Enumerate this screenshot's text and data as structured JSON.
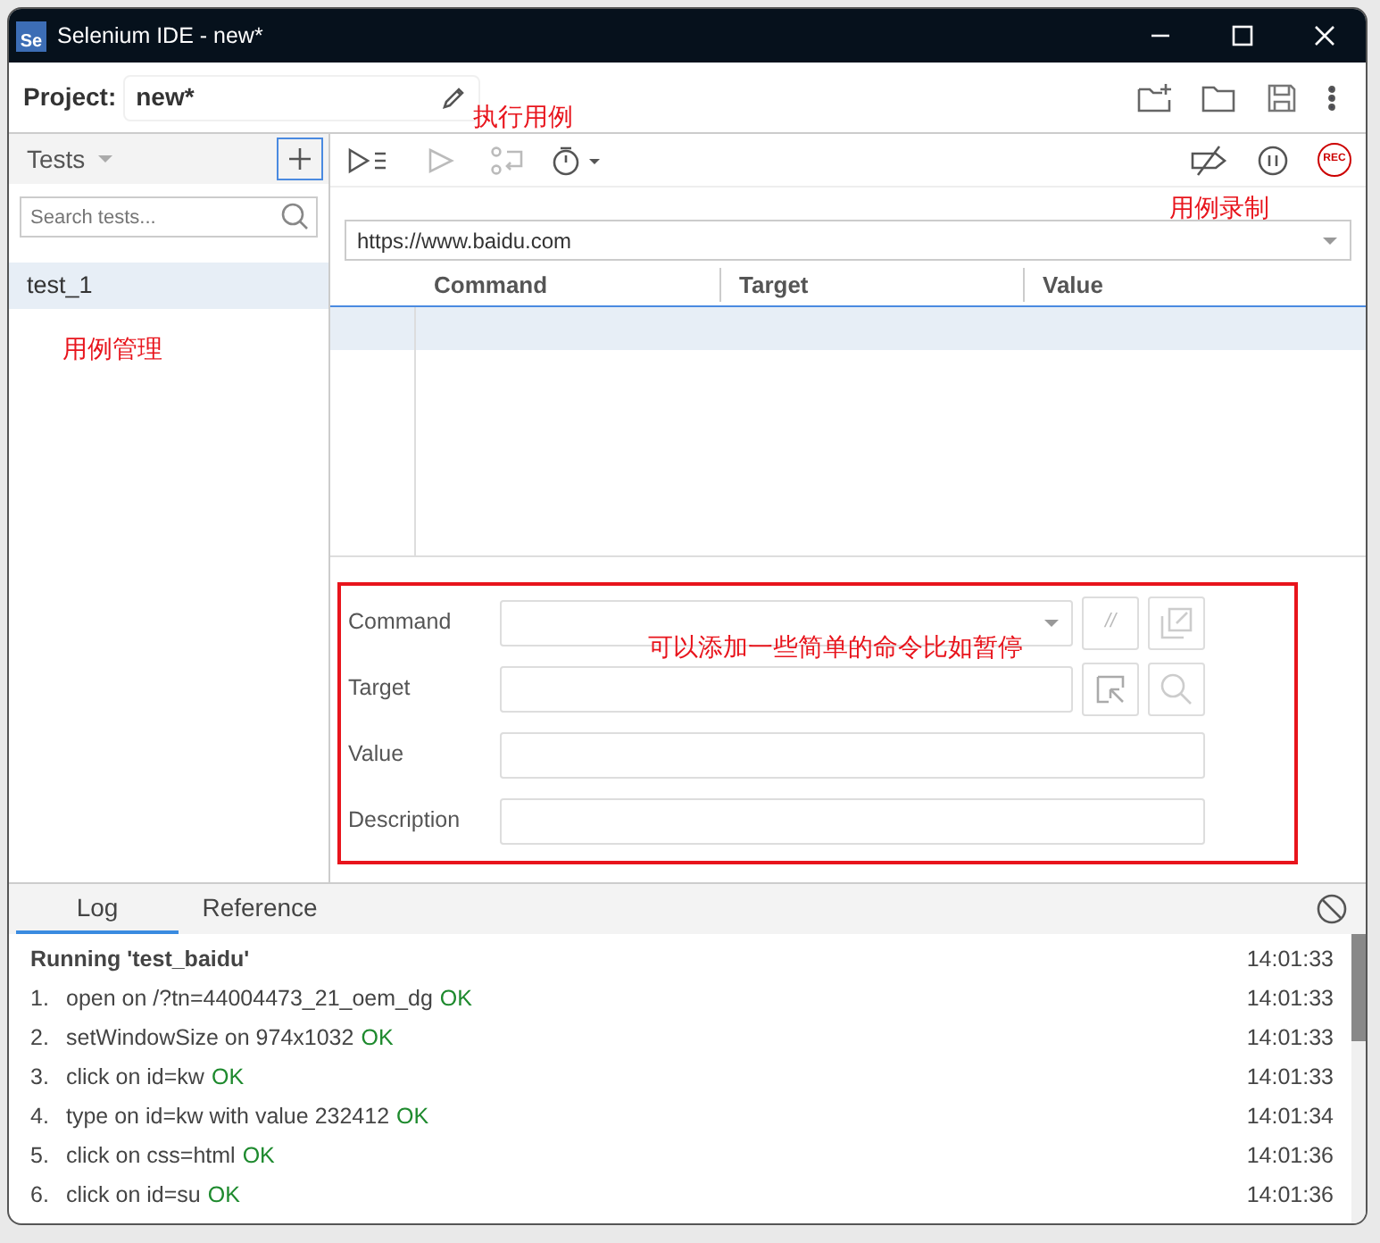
{
  "window": {
    "logo": "Se",
    "title": "Selenium IDE - new*"
  },
  "project": {
    "label": "Project:",
    "name": "new*"
  },
  "sidebar": {
    "header": "Tests",
    "search": {
      "placeholder": "Search tests..."
    },
    "tests": [
      {
        "name": "test_1",
        "selected": true
      }
    ],
    "annotation": "用例管理"
  },
  "toolbar": {
    "buttons": [
      {
        "kind": "run-all",
        "disabled": false
      },
      {
        "kind": "run",
        "disabled": true
      },
      {
        "kind": "step",
        "disabled": true
      },
      {
        "kind": "speed",
        "disabled": false
      }
    ],
    "record_label": "REC",
    "annotation": "执行用例",
    "record_annotation": "用例录制"
  },
  "url": {
    "value": "https://www.baidu.com"
  },
  "table": {
    "columns": [
      "Command",
      "Target",
      "Value"
    ],
    "rows": [
      {
        "selected": true
      }
    ]
  },
  "command_editor": {
    "highlighted": true,
    "annotation": "可以添加一些简单的命令比如暂停",
    "comment_button": "//",
    "fields": [
      {
        "kind": "command",
        "label": "Command"
      },
      {
        "kind": "target",
        "label": "Target"
      },
      {
        "kind": "value",
        "label": "Value"
      },
      {
        "kind": "description",
        "label": "Description"
      }
    ]
  },
  "log": {
    "tabs": [
      {
        "label": "Log",
        "selected": true
      },
      {
        "label": "Reference",
        "selected": false
      }
    ],
    "entries": [
      {
        "kind": "heading",
        "text": "Running 'test_baidu'",
        "time": "14:01:33"
      },
      {
        "kind": "step",
        "number": "1.",
        "text": "open on /?tn=44004473_21_oem_dg",
        "status": "OK",
        "time": "14:01:33"
      },
      {
        "kind": "step",
        "number": "2.",
        "text": "setWindowSize on 974x1032",
        "status": "OK",
        "time": "14:01:33"
      },
      {
        "kind": "step",
        "number": "3.",
        "text": "click on id=kw",
        "status": "OK",
        "time": "14:01:33"
      },
      {
        "kind": "step",
        "number": "4.",
        "text": "type on id=kw with value 232412",
        "status": "OK",
        "time": "14:01:34"
      },
      {
        "kind": "step",
        "number": "5.",
        "text": "click on css=html",
        "status": "OK",
        "time": "14:01:36"
      },
      {
        "kind": "step",
        "number": "6.",
        "text": "click on id=su",
        "status": "OK",
        "time": "14:01:36"
      }
    ]
  }
}
